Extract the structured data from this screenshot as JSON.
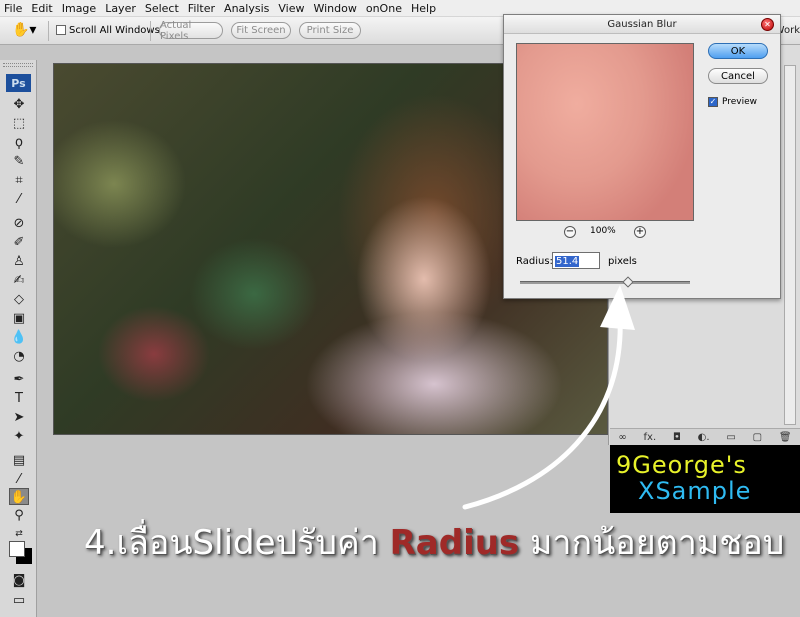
{
  "menu": [
    "File",
    "Edit",
    "Image",
    "Layer",
    "Select",
    "Filter",
    "Analysis",
    "View",
    "Window",
    "onOne",
    "Help"
  ],
  "options_bar": {
    "scroll_all_label": "Scroll All Windows",
    "actual_pixels": "Actual Pixels",
    "fit_screen": "Fit Screen",
    "print_size": "Print Size",
    "workspace": "Work"
  },
  "toolbox": {
    "logo": "Ps",
    "tools": [
      "move",
      "marquee",
      "lasso",
      "quick-select",
      "crop",
      "eyedropper",
      "healing",
      "brush",
      "clone-stamp",
      "history-brush",
      "eraser",
      "gradient",
      "blur",
      "dodge",
      "pen",
      "type",
      "path-select",
      "shape",
      "notes",
      "eyedropper-2",
      "hand",
      "zoom"
    ]
  },
  "dialog": {
    "title": "Gaussian Blur",
    "ok_label": "OK",
    "cancel_label": "Cancel",
    "preview_label": "Preview",
    "preview_checked": true,
    "zoom_level": "100%",
    "zoom_minus": "−",
    "zoom_plus": "+",
    "radius_label": "Radius:",
    "radius_value": "51.4",
    "radius_unit": "pixels"
  },
  "logo": {
    "line1": "9George's",
    "line2": "XSample"
  },
  "caption": {
    "prefix": "4.เลื่อนSlideปรับค่า ",
    "highlight": "Radius",
    "suffix": " มากน้อยตามชอบ"
  },
  "colors": {
    "highlight": "#9f2a28",
    "logo_yellow": "#e8f22a",
    "logo_blue": "#2fbbf2",
    "ok_button": "#4f9ff0"
  }
}
